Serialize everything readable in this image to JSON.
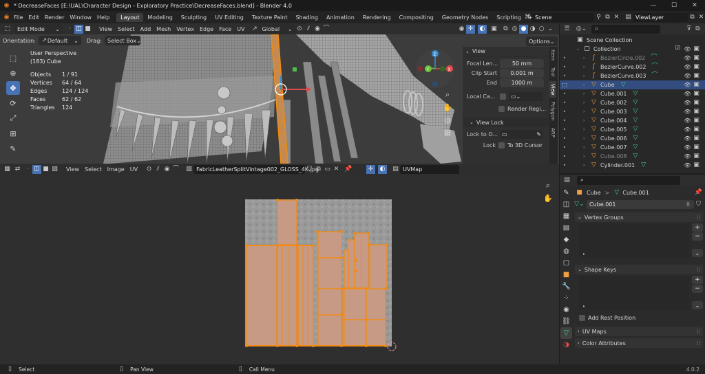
{
  "titlebar": {
    "title": "* DecreaseFaces [E:\\UAL\\Character Design - Exploratory Practice\\DecreaseFaces.blend] - Blender 4.0"
  },
  "menu": [
    "File",
    "Edit",
    "Render",
    "Window",
    "Help"
  ],
  "workspaces": [
    "Layout",
    "Modeling",
    "Sculpting",
    "UV Editing",
    "Texture Paint",
    "Shading",
    "Animation",
    "Rendering",
    "Compositing",
    "Geometry Nodes",
    "Scripting"
  ],
  "add_workspace": "+",
  "scene": {
    "label": "Scene"
  },
  "view_layer": {
    "label": "ViewLayer"
  },
  "viewport": {
    "mode": "Edit Mode",
    "menus": [
      "View",
      "Select",
      "Add",
      "Mesh",
      "Vertex",
      "Edge",
      "Face",
      "UV"
    ],
    "transform_space": "Global",
    "orientation_label": "Orientation:",
    "orientation_value": "Default",
    "drag_label": "Drag:",
    "drag_value": "Select Box",
    "options": "Options",
    "axes": {
      "x": "X",
      "y": "Y",
      "z": "Z"
    },
    "overlay_info": {
      "view_name": "User Perspective",
      "object_name": "(183) Cube",
      "stats": [
        {
          "label": "Objects",
          "value": "1 / 91"
        },
        {
          "label": "Vertices",
          "value": "64 / 64"
        },
        {
          "label": "Edges",
          "value": "124 / 124"
        },
        {
          "label": "Faces",
          "value": "62 / 62"
        },
        {
          "label": "Triangles",
          "value": "124"
        }
      ]
    }
  },
  "n_panel": {
    "view_header": "View",
    "focal_length_label": "Focal Len...",
    "focal_length_value": "50 mm",
    "clip_start_label": "Clip Start",
    "clip_start_value": "0.001 m",
    "clip_end_label": "End",
    "clip_end_value": "1000 m",
    "local_camera_label": "Local Ca...",
    "render_region_label": "Render Regi...",
    "view_lock_header": "View Lock",
    "lock_to_object_label": "Lock to O...",
    "lock_label": "Lock",
    "lock_to_cursor": "To 3D Cursor",
    "tabs": [
      "Item",
      "Tool",
      "View",
      "Polygon",
      "ARP"
    ]
  },
  "outliner": {
    "rows": [
      {
        "name": "Scene Collection",
        "kind": "scene",
        "indent": 0
      },
      {
        "name": "Collection",
        "kind": "collection",
        "indent": 1,
        "checked": true
      },
      {
        "name": "BezierCircle.002",
        "kind": "curve",
        "indent": 2,
        "dim": true
      },
      {
        "name": "BezierCurve.002",
        "kind": "curve",
        "indent": 2
      },
      {
        "name": "BezierCurve.003",
        "kind": "curve",
        "indent": 2
      },
      {
        "name": "Cube",
        "kind": "mesh",
        "indent": 2,
        "selected": true
      },
      {
        "name": "Cube.001",
        "kind": "mesh",
        "indent": 2
      },
      {
        "name": "Cube.002",
        "kind": "mesh",
        "indent": 2
      },
      {
        "name": "Cube.003",
        "kind": "mesh",
        "indent": 2
      },
      {
        "name": "Cube.004",
        "kind": "mesh",
        "indent": 2
      },
      {
        "name": "Cube.005",
        "kind": "mesh",
        "indent": 2
      },
      {
        "name": "Cube.006",
        "kind": "mesh",
        "indent": 2
      },
      {
        "name": "Cube.007",
        "kind": "mesh",
        "indent": 2
      },
      {
        "name": "Cube.008",
        "kind": "mesh",
        "indent": 2,
        "dim": true
      },
      {
        "name": "Cylinder.001",
        "kind": "mesh",
        "indent": 2
      }
    ]
  },
  "uv_editor": {
    "menus": [
      "View",
      "Select",
      "Image",
      "UV"
    ],
    "image_name": "FabricLeatherSplitVintage002_GLOSS_4K.jpg",
    "uv_map": "UVMap"
  },
  "properties": {
    "breadcrumb_object": "Cube",
    "breadcrumb_sep": ">",
    "breadcrumb_data": "Cube.001",
    "mesh_name": "Cube.001",
    "mesh_users": "8",
    "vertex_groups": "Vertex Groups",
    "shape_keys": "Shape Keys",
    "add_rest_position": "Add Rest Position",
    "uv_maps": "UV Maps",
    "color_attributes": "Color Attributes"
  },
  "statusbar": {
    "select": "Select",
    "pan_view": "Pan View",
    "call_menu": "Call Menu",
    "version": "4.0.2"
  },
  "colors": {
    "accent": "#4772b3",
    "orange_select": "#f28a14",
    "mesh_icon": "#f0a040",
    "data_icon": "#44d18b"
  }
}
